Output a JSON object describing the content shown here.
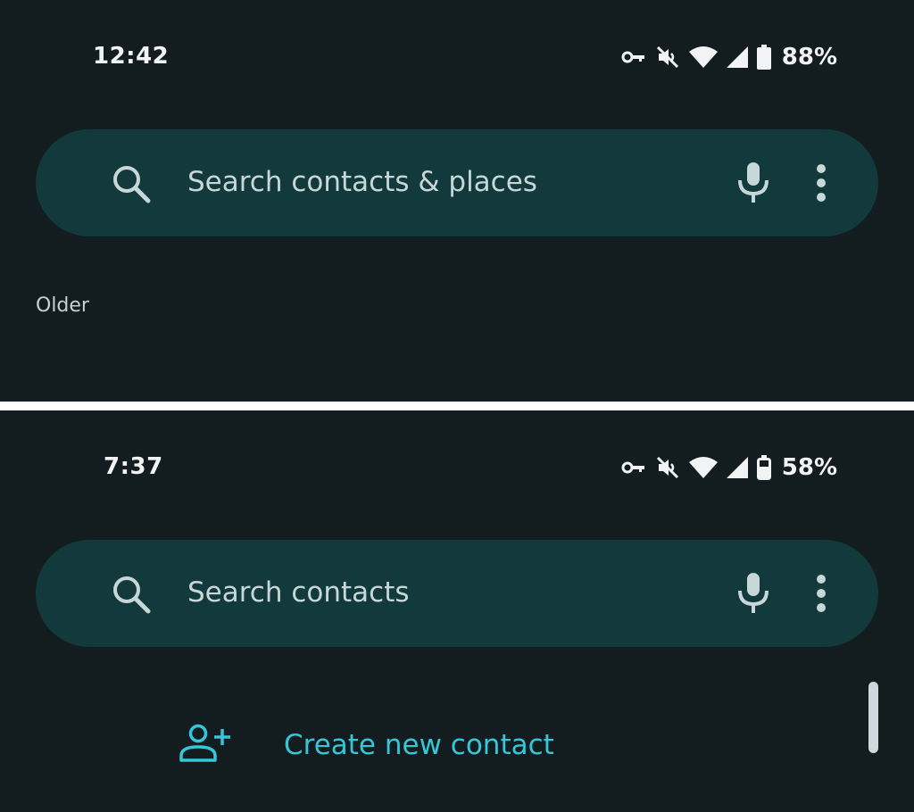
{
  "screen_top": {
    "status_bar": {
      "time": "12:42",
      "battery_percent": "88%",
      "icons": [
        "vpn-key-icon",
        "mute-icon",
        "wifi-icon",
        "signal-icon",
        "battery-icon"
      ]
    },
    "search": {
      "placeholder": "Search contacts & places",
      "icons": [
        "search-icon",
        "mic-icon",
        "more-vert-icon"
      ]
    },
    "section_label": "Older"
  },
  "screen_bottom": {
    "status_bar": {
      "time": "7:37",
      "battery_percent": "58%",
      "icons": [
        "vpn-key-icon",
        "mute-icon",
        "wifi-icon",
        "signal-icon",
        "battery-charging-icon"
      ]
    },
    "search": {
      "placeholder": "Search contacts",
      "icons": [
        "search-icon",
        "mic-icon",
        "more-vert-icon"
      ]
    },
    "create_contact_label": "Create new contact"
  },
  "colors": {
    "background": "#131d1f",
    "search_bar": "#12393b",
    "accent": "#35c7d8",
    "divider": "#ffffff"
  }
}
